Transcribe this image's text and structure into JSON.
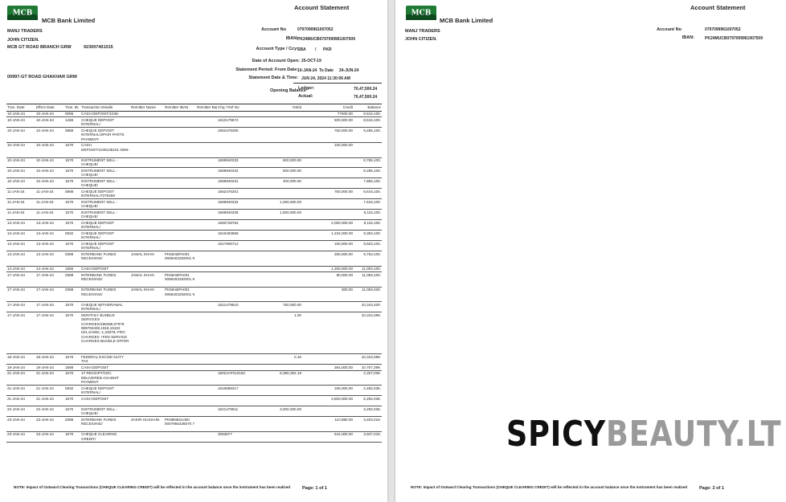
{
  "document": {
    "bank_name": "MCB Bank Limited",
    "statement_title": "Account Statement",
    "logo_text": "MCB",
    "colors": {
      "logo_green": "#1f7a34",
      "logo_dark": "#0d4a1f",
      "watermark_dark": "#111111",
      "watermark_grey": "#9a9a9a"
    }
  },
  "header": {
    "customer_name": "MANJ TRADERS",
    "customer_person": "JOHN CITIZEN.",
    "address": "MCB GT ROAD BRANCH GRW",
    "phone": "923007401015",
    "branch": "00997-GT ROAD GHAKHAR GRW",
    "account_no_label": "Account No",
    "account_no": "0797099961007052",
    "iban_label": "IBAN:",
    "iban": "PK24MUCB0797099961007509",
    "type_label": "Account Type / Ccy:",
    "type": "SBA",
    "type_sep": "/",
    "ccy": "PKR",
    "open_label": "Date of Account Open:",
    "open_date": "25-OCT-19",
    "period_label": "Statement Period: From Date:",
    "from_date": "10-JAN-24",
    "to_label": "To Date",
    "to_date": "24-JUN-24",
    "time_label": "Statement Date & Time:",
    "stmt_datetime": "JUN 24, 2024 11:30:06 AM",
    "opening_balance_label": "Opening Balance",
    "ledger_label": "Ledger:",
    "ledger": "70,47,500.24",
    "actual_label": "Actual:",
    "actual": "70,47,500.24"
  },
  "table": {
    "columns": [
      "Tran. Date",
      "Effect Date",
      "Tran. Br.",
      "Transaction Details",
      "Remitter Name",
      "Remitter IBAN",
      "Remitter Bank",
      "Chq / Ref No",
      "Debit",
      "Credit",
      "Balance"
    ],
    "rows": [
      {
        "tran": "10-JAN-24",
        "eff": "10-JAN-24",
        "br": "0086",
        "det": "CASH DEPOSIT/1045-",
        "rn": "",
        "ri": "",
        "rb": "",
        "chq": "",
        "deb": "",
        "cre": "77600.00",
        "bal": "8,515,100.",
        "h": 1
      },
      {
        "tran": "10-JAN-24",
        "eff": "10-JAN-24",
        "br": "1466",
        "det": "CHEQUE DEPOSIT INTERNAL/",
        "rn": "",
        "ri": "",
        "rb": "",
        "chq": "1610179672",
        "deb": "",
        "cre": "500,000.00",
        "bal": "8,515,100.",
        "h": 2
      },
      {
        "tran": "10-JAN-24",
        "eff": "10-JAN-24",
        "br": "0888",
        "det": "CHEQUE DEPOSIT INTERNAL/SPAIR PARTS PAYMENT-",
        "rn": "",
        "ri": "",
        "rb": "",
        "chq": "1652476300",
        "deb": "",
        "cre": "750,000.00",
        "bal": "9,265,100.",
        "h": 3
      },
      {
        "tran": "10-JAN-24",
        "eff": "10-JAN-24",
        "br": "1570",
        "det": "CASH DEPOSIT/1045135101 0084-",
        "rn": "",
        "ri": "",
        "rb": "",
        "chq": "",
        "deb": "",
        "cre": "100,000.00",
        "bal": "",
        "h": 3
      },
      {
        "tran": "10-JAN-24",
        "eff": "10-JAN-24",
        "br": "1570",
        "det": "INSTRUMENT SELL - CHEQUE/",
        "rn": "",
        "ri": "",
        "rb": "",
        "chq": "1669940333",
        "deb": "600,000.00",
        "cre": "",
        "bal": "8,765,100.",
        "h": 2
      },
      {
        "tran": "10-JAN-24",
        "eff": "10-JAN-24",
        "br": "1570",
        "det": "INSTRUMENT SELL - CHEQUE/",
        "rn": "",
        "ri": "",
        "rb": "",
        "chq": "1669940332",
        "deb": "500,000.00",
        "cre": "",
        "bal": "8,265,100.",
        "h": 2
      },
      {
        "tran": "10-JAN-24",
        "eff": "10-JAN-24",
        "br": "1570",
        "det": "INSTRUMENT SELL - CHEQUE/",
        "rn": "",
        "ri": "",
        "rb": "",
        "chq": "1669940331",
        "deb": "400,000.00",
        "cre": "",
        "bal": "7,865,100.",
        "h": 2
      },
      {
        "tran": "11-JAN-24",
        "eff": "11-JAN-24",
        "br": "0888",
        "det": "CHEQUE DEPOSIT INTERNAL/7379469",
        "rn": "",
        "ri": "",
        "rb": "",
        "chq": "1652476301",
        "deb": "",
        "cre": "750,000.00",
        "bal": "8,615,100.",
        "h": 2
      },
      {
        "tran": "11-JAN-24",
        "eff": "11-JAN-24",
        "br": "1570",
        "det": "INSTRUMENT SELL - CHEQUE/",
        "rn": "",
        "ri": "",
        "rb": "",
        "chq": "1669940334",
        "deb": "1,000,000.00",
        "cre": "",
        "bal": "7,615,100.",
        "h": 2
      },
      {
        "tran": "11-JAN-24",
        "eff": "11-JAN-24",
        "br": "1570",
        "det": "INSTRUMENT SELL - CHEQUE/",
        "rn": "",
        "ri": "",
        "rb": "",
        "chq": "1669940335",
        "deb": "1,500,000.00",
        "cre": "",
        "bal": "6,115,100.",
        "h": 2
      },
      {
        "tran": "13-JAN-24",
        "eff": "13-JAN-24",
        "br": "1570",
        "det": "CHEQUE DEPOSIT INTERNAL/",
        "rn": "",
        "ri": "",
        "rb": "",
        "chq": "1650728764",
        "deb": "",
        "cre": "2,000,000.00",
        "bal": "8,115,100.",
        "h": 2
      },
      {
        "tran": "13-JAN-24",
        "eff": "13-JAN-24",
        "br": "0832",
        "det": "CHEQUE DEPOSIT INTERNAL/",
        "rn": "",
        "ri": "",
        "rb": "",
        "chq": "1616493656",
        "deb": "",
        "cre": "1,234,000.00",
        "bal": "9,353,100.",
        "h": 2
      },
      {
        "tran": "13-JAN-24",
        "eff": "13-JAN-24",
        "br": "1570",
        "det": "CHEQUE DEPOSIT INTERNAL/",
        "rn": "",
        "ri": "",
        "rb": "",
        "chq": "1617905712",
        "deb": "",
        "cre": "150,000.00",
        "bal": "9,503,100.",
        "h": 2
      },
      {
        "tran": "13-JAN-24",
        "eff": "13-JAN-24",
        "br": "0398",
        "det": "INTERBANK FUNDS RECEIVING/",
        "rn": "JAMAL KHAN",
        "ri": "PK58ABPA001 0058402292001 9",
        "rb": "",
        "chq": "",
        "deb": "",
        "cre": "250,000.00",
        "bal": "9,753,100.",
        "h": 3
      },
      {
        "tran": "14-JAN-24",
        "eff": "14-JAN-24",
        "br": "1655",
        "det": "CASH DEPOSIT",
        "rn": "",
        "ri": "",
        "rb": "",
        "chq": "",
        "deb": "",
        "cre": "1,250,000.00",
        "bal": "11,003,100.",
        "h": 1
      },
      {
        "tran": "17-JAN-24",
        "eff": "17-JAN-24",
        "br": "0398",
        "det": "INTERBANK FUNDS RECEIVING/",
        "rn": "JAMAL KHAN",
        "ri": "PK58ABPA001 0058402292001 9",
        "rb": "",
        "chq": "",
        "deb": "",
        "cre": "80,000.00",
        "bal": "11,083,100.",
        "h": 3
      },
      {
        "tran": "17-JAN-24",
        "eff": "17-JAN-24",
        "br": "0398",
        "det": "INTERBANK FUNDS RECEIVING/",
        "rn": "JAMAL KHAN",
        "ri": "PK58ABPA001 0058402292001 9",
        "rb": "",
        "chq": "",
        "deb": "",
        "cre": "300.00",
        "bal": "11,083,400.",
        "h": 3
      },
      {
        "tran": "17-JAN-24",
        "eff": "17-JAN-24",
        "br": "1570",
        "det": "CHEQUE WITHDRAWAL INTERNAL/",
        "rn": "",
        "ri": "",
        "rb": "",
        "chq": "1621479510",
        "deb": "750,000.00",
        "cre": "",
        "bal": "10,343,400.",
        "h": 2
      },
      {
        "tran": "17-JAN-24",
        "eff": "17-JAN-24",
        "br": "1570",
        "det": "MONTHLY BUNDLE SERVICES CHARGES/188489,07978 889783408,1918,15102 021,SA802,-1,34878,-FRO CHARGES +FED SERVICE CHARGES BUNDLE OFFER",
        "rn": "",
        "ri": "",
        "rb": "",
        "chq": "",
        "deb": "1.00",
        "cre": "",
        "bal": "10,343,399.",
        "h": 9
      },
      {
        "tran": "18-JAN-24",
        "eff": "18-JAN-24",
        "br": "1570",
        "det": "FEDERAL EXCISE DUTY TAX",
        "rn": "",
        "ri": "",
        "rb": "",
        "chq": "",
        "deb": "0.16",
        "cre": "",
        "bal": "10,343,399.",
        "h": 2
      },
      {
        "tran": "19-JAN-24",
        "eff": "19-JAN-24",
        "br": "1888",
        "det": "CASH DEPOSIT",
        "rn": "",
        "ri": "",
        "rb": "",
        "chq": "",
        "deb": "",
        "cre": "364,000.00",
        "bal": "10,707,399.",
        "h": 1
      },
      {
        "tran": "21-JAN-24",
        "eff": "21-JAN-24",
        "br": "1570",
        "det": "1T RECEIPT/CDC DELIVERED AGAINST PAYMENT",
        "rn": "",
        "ri": "",
        "rb": "",
        "chq": "1602JAP210153",
        "deb": "8,380,362.16",
        "cre": "",
        "bal": "2,327,036.",
        "h": 3
      },
      {
        "tran": "21-JAN-24",
        "eff": "21-JAN-24",
        "br": "0832",
        "det": "CHEQUE DEPOSIT INTERNAL/",
        "rn": "",
        "ri": "",
        "rb": "",
        "chq": "1616868317",
        "deb": "",
        "cre": "165,000.00",
        "bal": "2,492,036.",
        "h": 2
      },
      {
        "tran": "21-JAN-24",
        "eff": "21-JAN-24",
        "br": "1570",
        "det": "CASH DEPOSIT",
        "rn": "",
        "ri": "",
        "rb": "",
        "chq": "",
        "deb": "",
        "cre": "3,800,000.00",
        "bal": "6,292,036.",
        "h": 2
      },
      {
        "tran": "22-JAN-24",
        "eff": "22-JAN-24",
        "br": "1570",
        "det": "INSTRUMENT SELL - CHEQUE/",
        "rn": "",
        "ri": "",
        "rb": "",
        "chq": "1621479511",
        "deb": "3,000,000.00",
        "cre": "",
        "bal": "3,292,036.",
        "h": 2
      },
      {
        "tran": "23-JAN-24",
        "eff": "23-JAN-24",
        "br": "0398",
        "det": "INTERBANK FUNDS RECEIVING/",
        "rn": "ZAKIR HUSSAIN",
        "ri": "PK98NBSL000 0007965335070 7",
        "rb": "",
        "chq": "",
        "deb": "",
        "cre": "110,980.00",
        "bal": "3,403,016.",
        "h": 3
      },
      {
        "tran": "23-JAN-24",
        "eff": "23-JAN-24",
        "br": "1570",
        "det": "CHEQUE CLEARING CREDIT/",
        "rn": "",
        "ri": "",
        "rb": "",
        "chq": "3083877",
        "deb": "",
        "cre": "544,000.00",
        "bal": "3,947,016.",
        "h": 2
      }
    ]
  },
  "footer": {
    "note": "NOTE: Impact of Outward Clearing Transactions (CHEQUE CLEARING CREDIT) will be reflected in the account balance once the instrument has been realized",
    "page1": "Page: 1 of 1",
    "page2": "Page: 2 of 1"
  },
  "watermark": {
    "part1": "SPICY",
    "part2": "BEAUTY.LT"
  }
}
